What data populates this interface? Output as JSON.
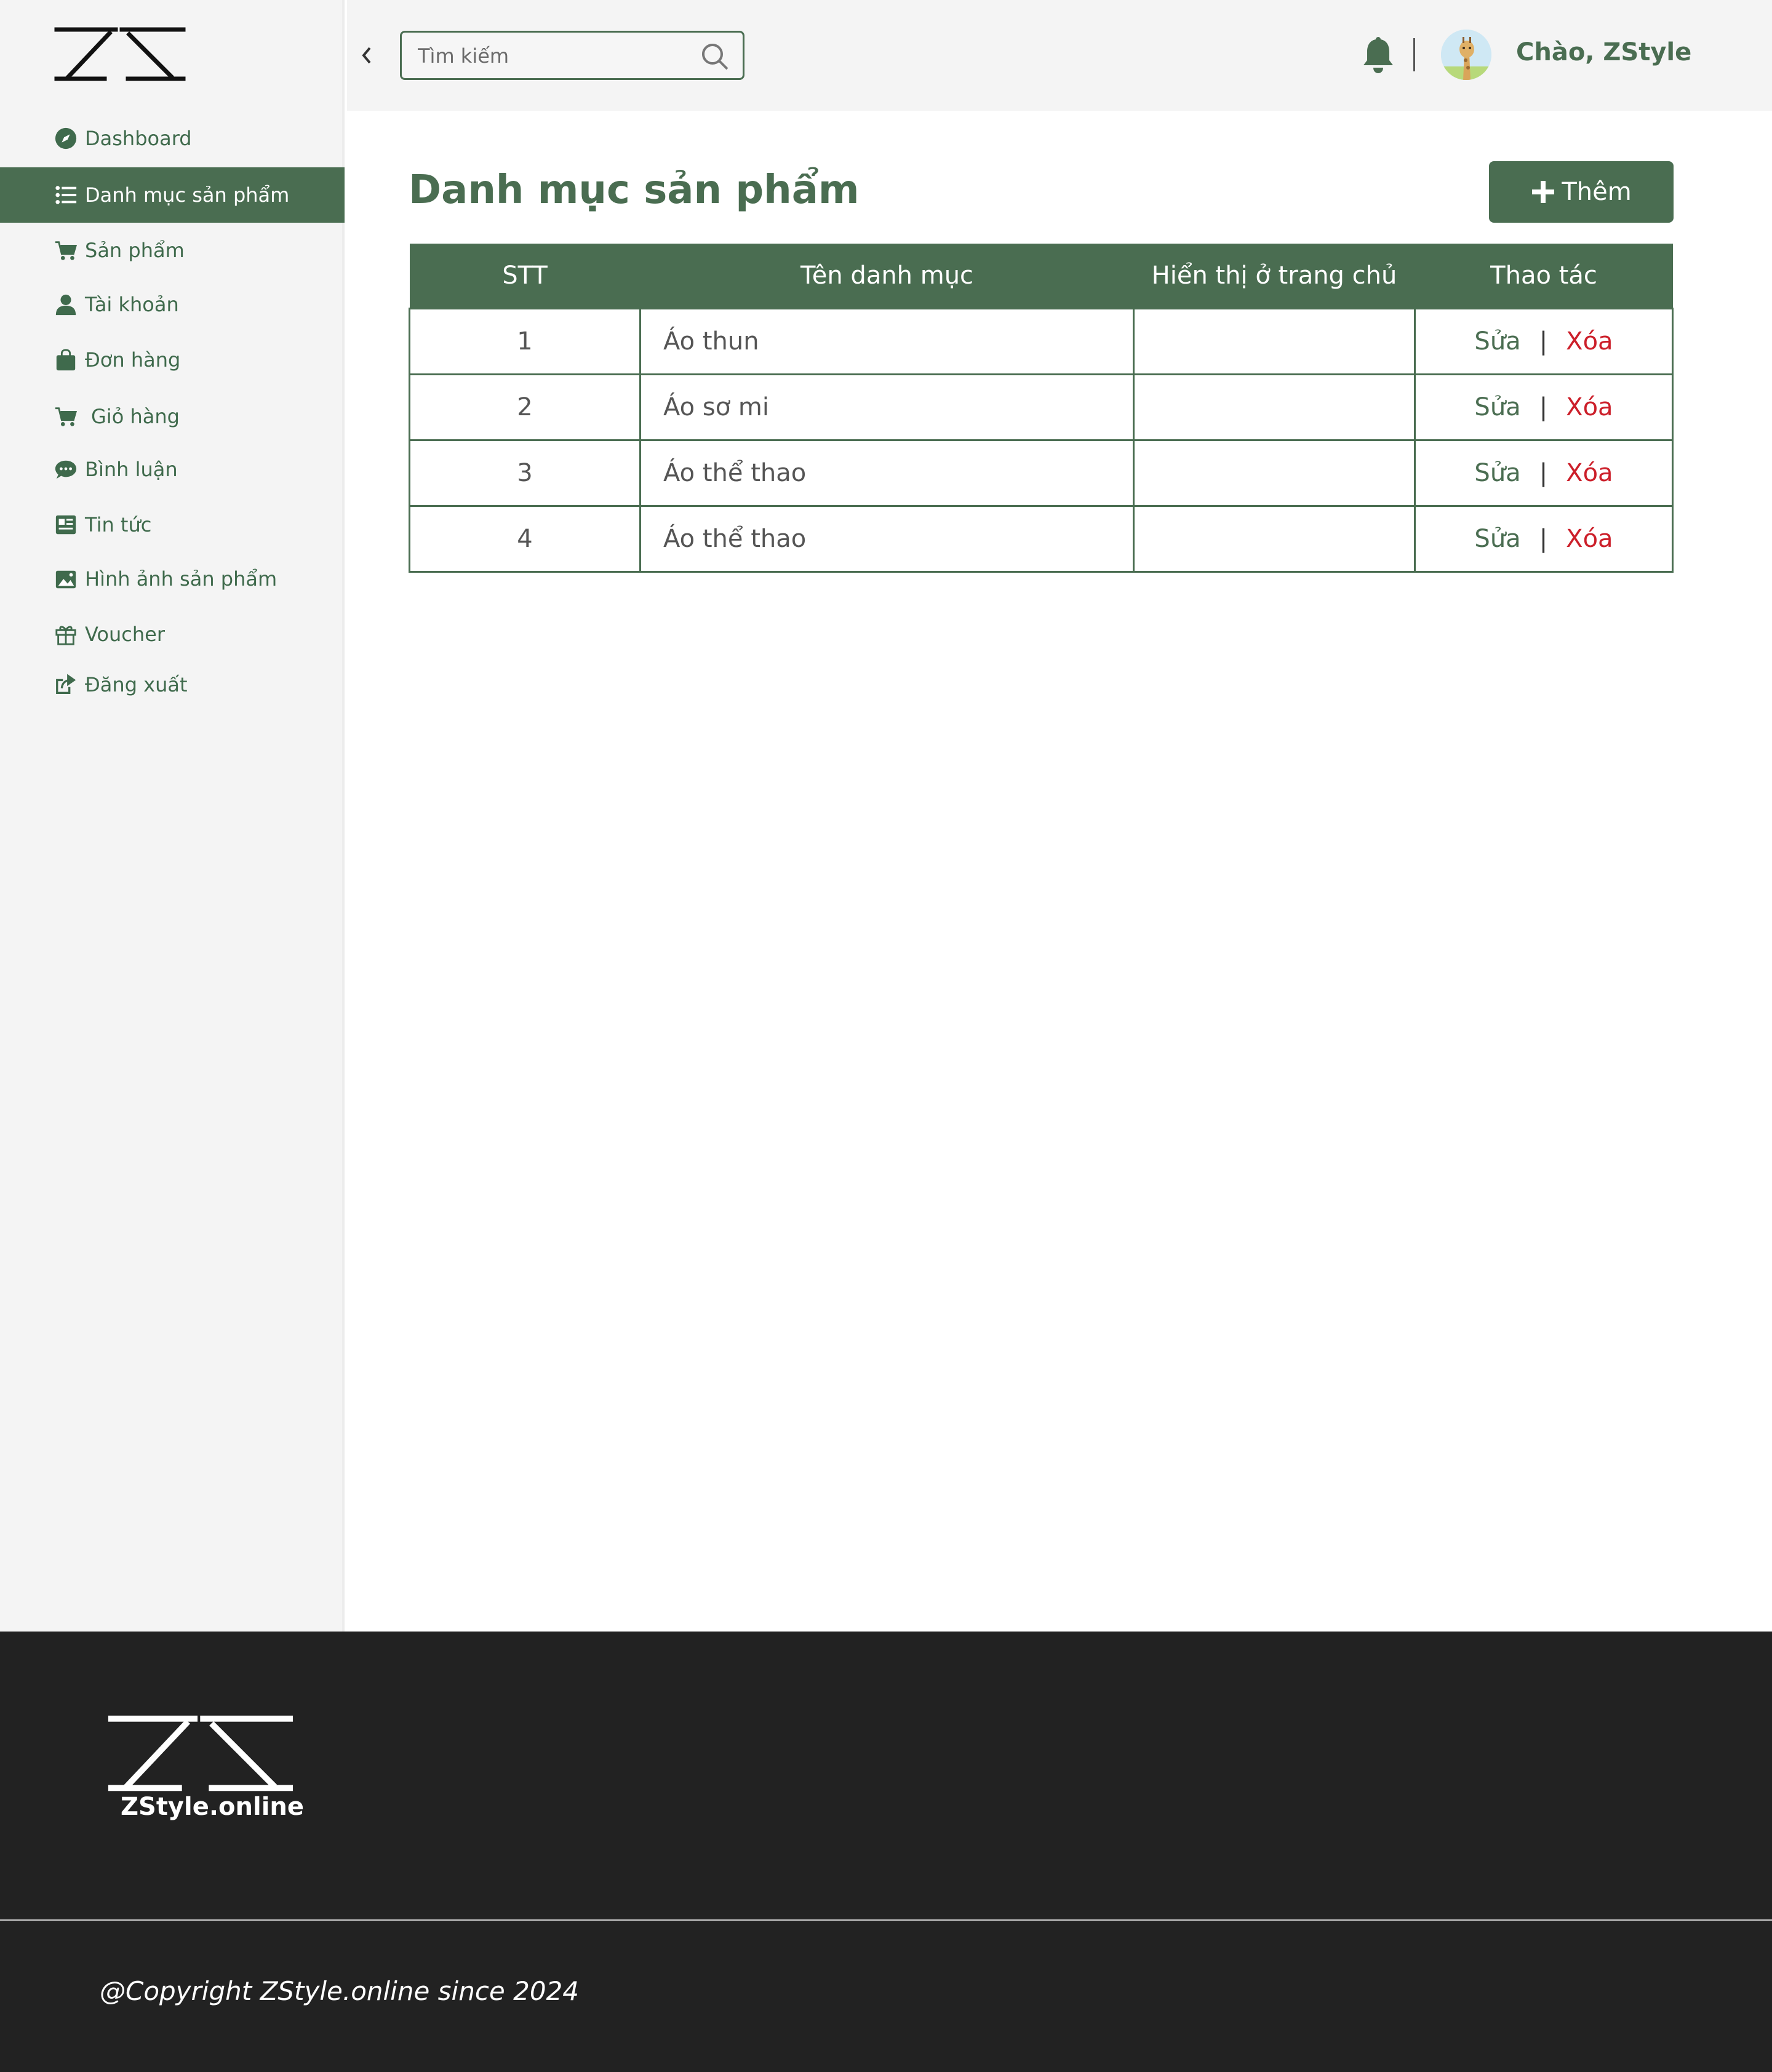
{
  "brand": {
    "logo_text": "ZS",
    "footer_name": "ZStyle.online",
    "copyright": "@Copyright ZStyle.online since 2024"
  },
  "topbar": {
    "search_placeholder": "Tìm kiếm",
    "greeting": "Chào, ZStyle"
  },
  "sidebar": {
    "items": [
      {
        "label": "Dashboard",
        "icon": "compass-icon",
        "active": false
      },
      {
        "label": "Danh mục sản phẩm",
        "icon": "list-icon",
        "active": true
      },
      {
        "label": "Sản phẩm",
        "icon": "cart-icon",
        "active": false
      },
      {
        "label": "Tài khoản",
        "icon": "user-icon",
        "active": false
      },
      {
        "label": "Đơn hàng",
        "icon": "shopping-bag-icon",
        "active": false
      },
      {
        "label": "Giỏ hàng",
        "icon": "cart-icon",
        "active": false
      },
      {
        "label": "Bình luận",
        "icon": "comment-icon",
        "active": false
      },
      {
        "label": "Tin tức",
        "icon": "newspaper-icon",
        "active": false
      },
      {
        "label": "Hình ảnh sản phẩm",
        "icon": "image-icon",
        "active": false
      },
      {
        "label": "Voucher",
        "icon": "gift-icon",
        "active": false
      },
      {
        "label": "Đăng xuất",
        "icon": "logout-icon",
        "active": false
      }
    ]
  },
  "main": {
    "title": "Danh mục sản phẩm",
    "add_label": "Thêm",
    "table": {
      "headers": [
        "STT",
        "Tên danh mục",
        "Hiển thị ở trang chủ",
        "Thao tác"
      ],
      "rows": [
        {
          "stt": "1",
          "name": "Áo thun",
          "show": ""
        },
        {
          "stt": "2",
          "name": "Áo sơ mi",
          "show": ""
        },
        {
          "stt": "3",
          "name": "Áo thể thao",
          "show": ""
        },
        {
          "stt": "4",
          "name": "Áo thể thao",
          "show": ""
        }
      ],
      "edit_label": "Sửa",
      "separator": "|",
      "delete_label": "Xóa"
    }
  },
  "colors": {
    "primary": "#4a6d51",
    "danger": "#cc1f2a",
    "sidebar_bg": "#f4f4f4",
    "footer_bg": "#222222"
  }
}
